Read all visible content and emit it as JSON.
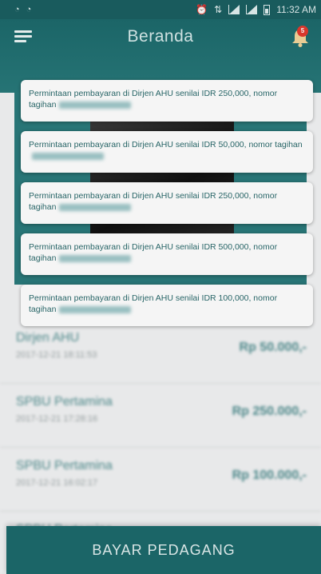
{
  "status_bar": {
    "time": "11:32 AM"
  },
  "app_bar": {
    "title": "Beranda",
    "notification_count": "5"
  },
  "notifications": [
    {
      "text": "Permintaan pembayaran di Dirjen AHU senilai IDR 250,000, nomor tagihan"
    },
    {
      "text": "Permintaan pembayaran di Dirjen AHU senilai IDR 50,000, nomor tagihan"
    },
    {
      "text": "Permintaan pembayaran di Dirjen AHU senilai IDR 250,000, nomor tagihan"
    },
    {
      "text": "Permintaan pembayaran di Dirjen AHU senilai IDR 500,000, nomor tagihan"
    },
    {
      "text": "Permintaan pembayaran di Dirjen AHU senilai IDR 100,000, nomor tagihan"
    }
  ],
  "transactions": [
    {
      "name": "Dirjen AHU",
      "date": "2017-12-21 18:11:53",
      "amount": "Rp 50.000,-"
    },
    {
      "name": "SPBU Pertamina",
      "date": "2017-12-21 17:28:16",
      "amount": "Rp 250.000,-"
    },
    {
      "name": "SPBU Pertamina",
      "date": "2017-12-21 16:02:17",
      "amount": "Rp 100.000,-"
    },
    {
      "name": "SPBU Pertamina",
      "date": "",
      "amount": ""
    }
  ],
  "bottom_button": {
    "label": "BAYAR PEDAGANG"
  },
  "colors": {
    "primary": "#1d6a6c",
    "badge": "#e23a2e"
  },
  "icons": [
    "menu-icon",
    "bell-icon",
    "alarm-icon",
    "signal-icon",
    "battery-icon"
  ]
}
